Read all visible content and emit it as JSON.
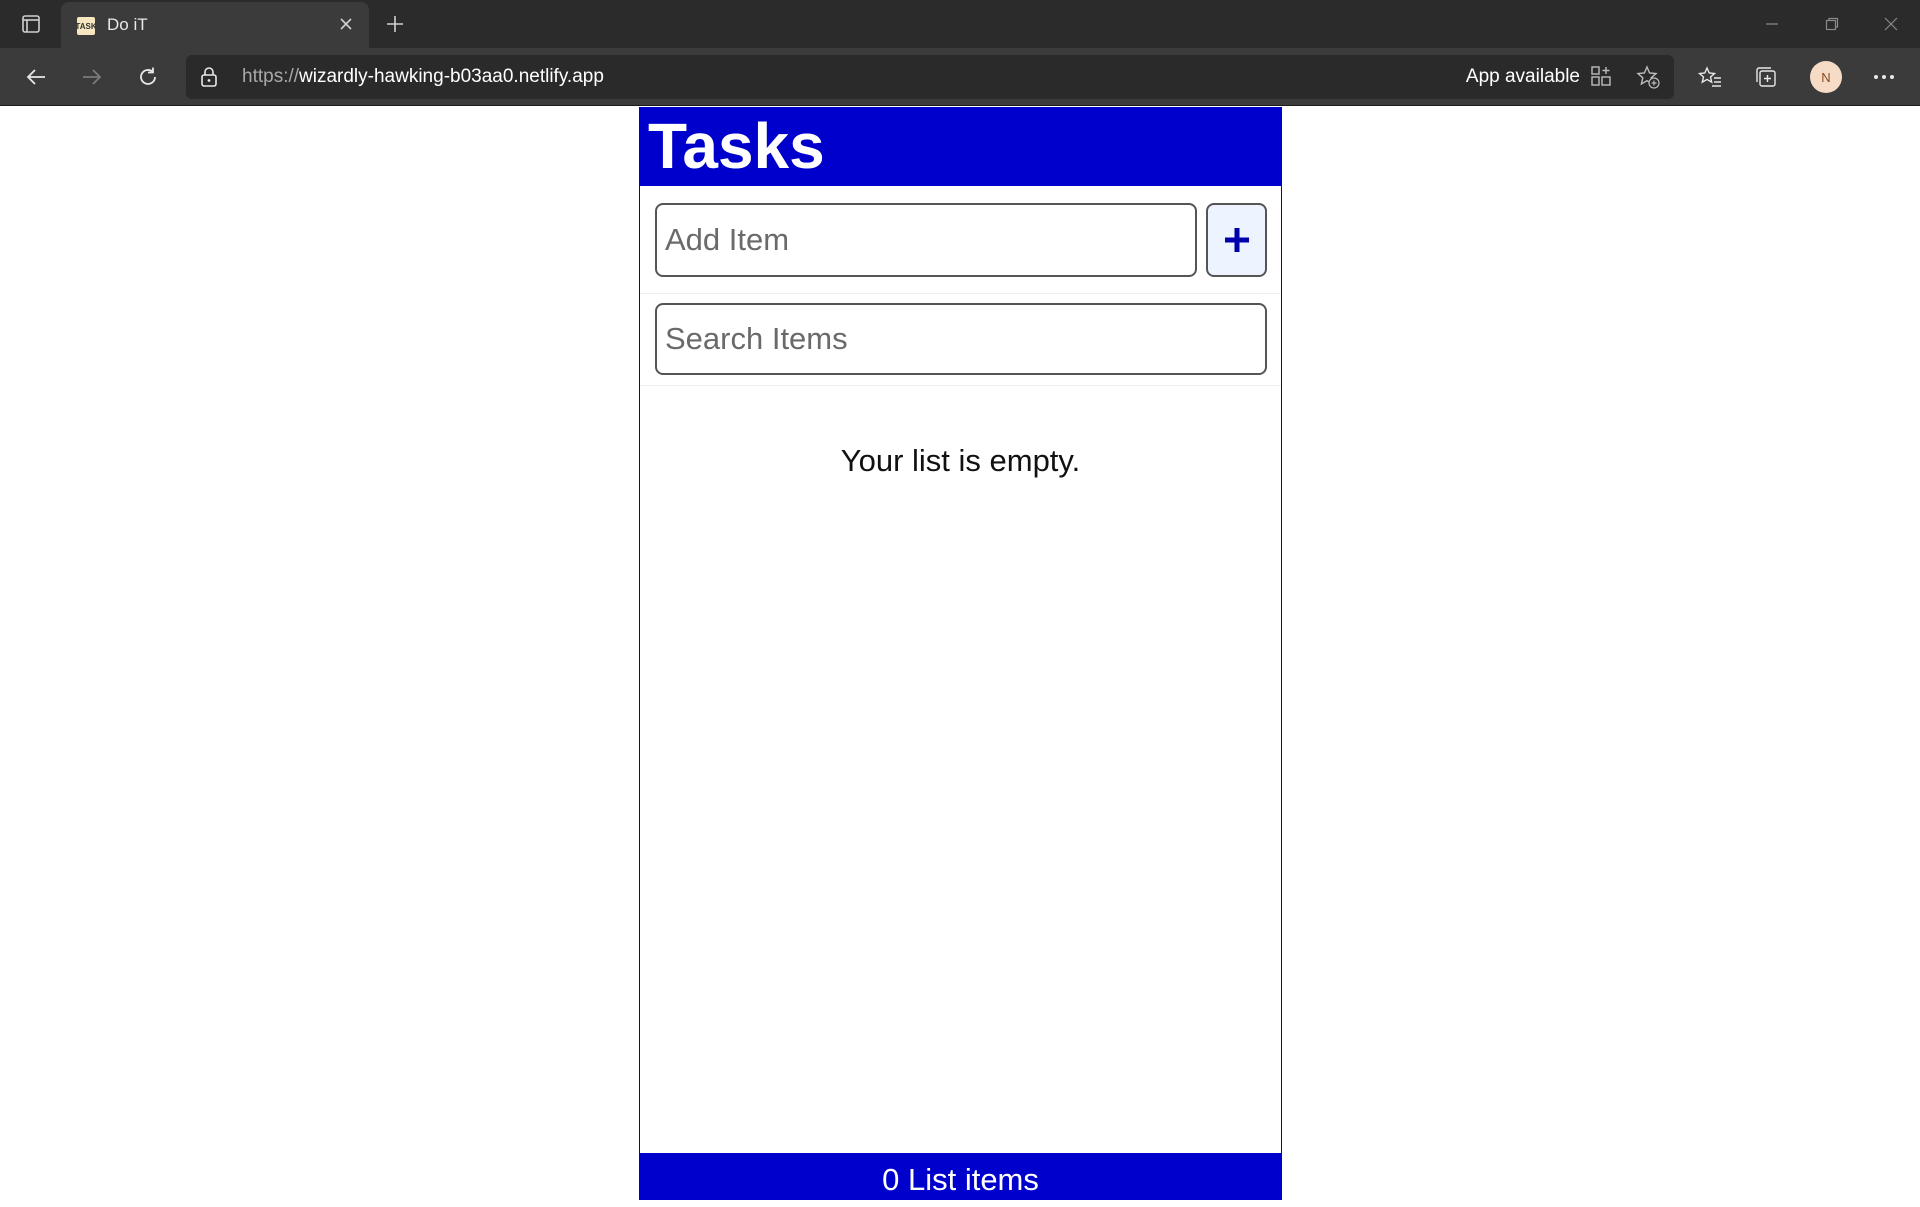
{
  "browser": {
    "tab": {
      "title": "Do iT",
      "favicon_text": "TASK"
    },
    "address": {
      "scheme": "https://",
      "host": "wizardly-hawking-b03aa0.netlify.app"
    },
    "app_available_label": "App available",
    "profile_initial": "N",
    "icons": [
      "tab-actions-icon",
      "close-icon",
      "new-tab-icon",
      "minimize-icon",
      "restore-icon",
      "window-close-icon",
      "back-icon",
      "forward-icon",
      "refresh-icon",
      "lock-icon",
      "app-install-icon",
      "add-favorite-icon",
      "favorites-icon",
      "collections-icon",
      "more-icon"
    ]
  },
  "app": {
    "title": "Tasks",
    "add_item": {
      "placeholder": "Add Item",
      "value": "",
      "button_icon": "plus-icon"
    },
    "search": {
      "placeholder": "Search Items",
      "value": ""
    },
    "empty_message": "Your list is empty.",
    "footer": "0 List items",
    "colors": {
      "brand": "#0000cc",
      "button_bg": "#eef4ff"
    }
  }
}
